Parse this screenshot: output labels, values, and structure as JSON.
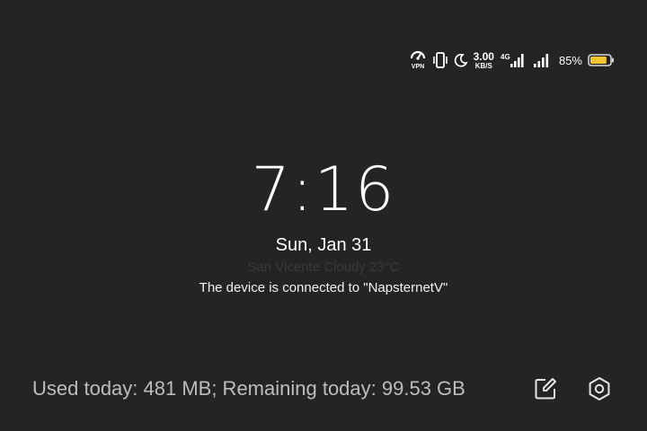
{
  "status_bar": {
    "icons": [
      "vpn-icon",
      "vibrate-icon",
      "moon-icon",
      "4g-signal-icon",
      "signal-icon",
      "battery-icon"
    ],
    "vpn_label": "VPN",
    "net_speed_value": "3.00",
    "net_speed_unit": "KB/S",
    "network_type": "4G",
    "battery_percent": "85%",
    "battery_level": 0.85,
    "battery_color": "#f2c631"
  },
  "lockscreen": {
    "time": "7:16",
    "date": "Sun, Jan 31",
    "weather": "San Vicente Cloudy 23°C",
    "connection_message": "The device is connected to \"NapsternetV\""
  },
  "footer": {
    "usage_text": "Used today: 481 MB; Remaining today: 99.53 GB",
    "icons": [
      "edit-icon",
      "settings-icon"
    ]
  },
  "colors": {
    "background": "#242424",
    "text_primary": "#ffffff",
    "text_muted": "#bdbdbd"
  }
}
